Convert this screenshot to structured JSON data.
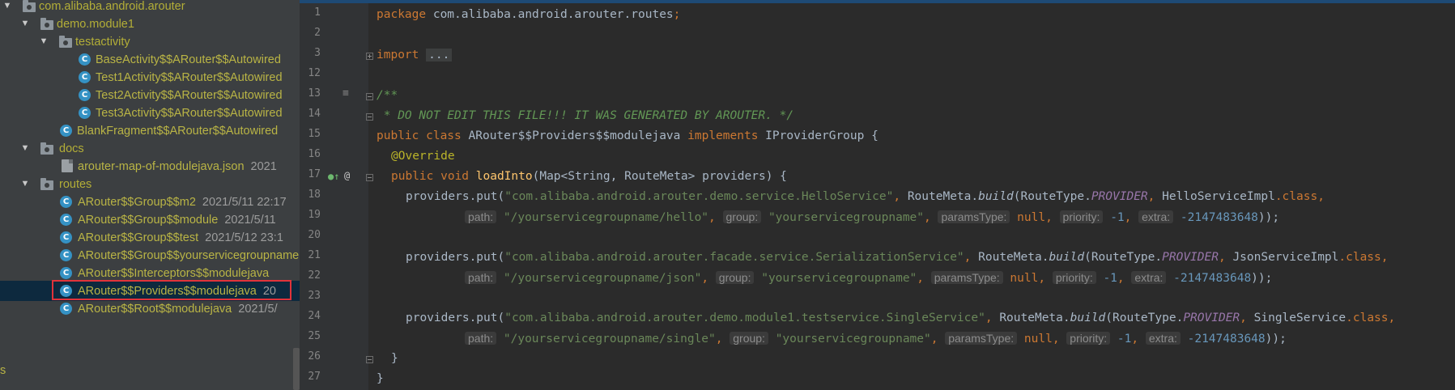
{
  "tree": {
    "items": [
      {
        "label": "com.alibaba.android.arouter",
        "date": "",
        "type": "package",
        "expanded": true
      },
      {
        "label": "demo.module1",
        "date": "",
        "type": "package",
        "expanded": true
      },
      {
        "label": "testactivity",
        "date": "",
        "type": "package",
        "expanded": true
      },
      {
        "label": "BaseActivity$$ARouter$$Autowired",
        "date": "",
        "type": "class"
      },
      {
        "label": "Test1Activity$$ARouter$$Autowired",
        "date": "",
        "type": "class"
      },
      {
        "label": "Test2Activity$$ARouter$$Autowired",
        "date": "",
        "type": "class"
      },
      {
        "label": "Test3Activity$$ARouter$$Autowired",
        "date": "",
        "type": "class"
      },
      {
        "label": "BlankFragment$$ARouter$$Autowired",
        "date": "",
        "type": "class"
      },
      {
        "label": "docs",
        "date": "",
        "type": "package",
        "expanded": true
      },
      {
        "label": "arouter-map-of-modulejava.json",
        "date": "2021",
        "type": "json"
      },
      {
        "label": "routes",
        "date": "",
        "type": "package",
        "expanded": true
      },
      {
        "label": "ARouter$$Group$$m2",
        "date": "2021/5/11 22:17",
        "type": "class"
      },
      {
        "label": "ARouter$$Group$$module",
        "date": "2021/5/11",
        "type": "class"
      },
      {
        "label": "ARouter$$Group$$test",
        "date": "2021/5/12 23:1",
        "type": "class"
      },
      {
        "label": "ARouter$$Group$$yourservicegroupname",
        "date": "",
        "type": "class"
      },
      {
        "label": "ARouter$$Interceptors$$modulejava",
        "date": "",
        "type": "class"
      },
      {
        "label": "ARouter$$Providers$$modulejava",
        "date": "20",
        "type": "class",
        "selected": true
      },
      {
        "label": "ARouter$$Root$$modulejava",
        "date": "2021/5/",
        "type": "class"
      }
    ],
    "bottom_label": "s"
  },
  "editor": {
    "line_numbers": [
      "1",
      "2",
      "3",
      "12",
      "13",
      "14",
      "15",
      "16",
      "17",
      "18",
      "19",
      "20",
      "21",
      "22",
      "23",
      "24",
      "25",
      "26",
      "27"
    ],
    "code": {
      "l1_kw": "package",
      "l1_text": " com.alibaba.android.arouter.routes",
      "l1_semi": ";",
      "l3_kw": "import",
      "l3_dots": "...",
      "l13": "/**",
      "l14": " * DO NOT EDIT THIS FILE!!! IT WAS GENERATED BY AROUTER. */",
      "l15_kw1": "public class ",
      "l15_name": "ARouter$$Providers$$modulejava ",
      "l15_kw2": "implements ",
      "l15_iface": "IProviderGroup {",
      "l16": "@Override",
      "l17_kw": "public void ",
      "l17_fn": "loadInto",
      "l17_rest": "(Map<String, RouteMeta> providers) {",
      "entries": [
        {
          "put": "providers.put(",
          "key": "\"com.alibaba.android.arouter.demo.service.HelloService\"",
          "impl": "HelloServiceImpl",
          "path": "\"/yourservicegroupname/hello\"",
          "group": "\"yourservicegroupname\""
        },
        {
          "put": "providers.put(",
          "key": "\"com.alibaba.android.arouter.facade.service.SerializationService\"",
          "impl": "JsonServiceImpl",
          "path": "\"/yourservicegroupname/json\"",
          "group": "\"yourservicegroupname\""
        },
        {
          "put": "providers.put(",
          "key": "\"com.alibaba.android.arouter.demo.module1.testservice.SingleService\"",
          "impl": "SingleService",
          "path": "\"/yourservicegroupname/single\"",
          "group": "\"yourservicegroupname\""
        }
      ],
      "comma": ", ",
      "route_meta": "RouteMeta.",
      "build": "build",
      "route_type": "(RouteType.",
      "provider": "PROVIDER",
      "class_kw": ".class",
      "hint_path": "path:",
      "hint_group": "group:",
      "hint_params": "paramsType:",
      "hint_priority": "priority:",
      "hint_extra": "extra:",
      "null_kw": "null",
      "priority_val": "-1",
      "extra_val": "-2147483648",
      "close": "));",
      "l26": "}",
      "l27": "}"
    }
  },
  "colors": {
    "tree_bg": "#3c3f41",
    "editor_bg": "#2b2b2b",
    "gutter_bg": "#313335",
    "keyword": "#cc7832",
    "string": "#6a8759",
    "number": "#6897bb",
    "selection_border": "#e0333a"
  }
}
